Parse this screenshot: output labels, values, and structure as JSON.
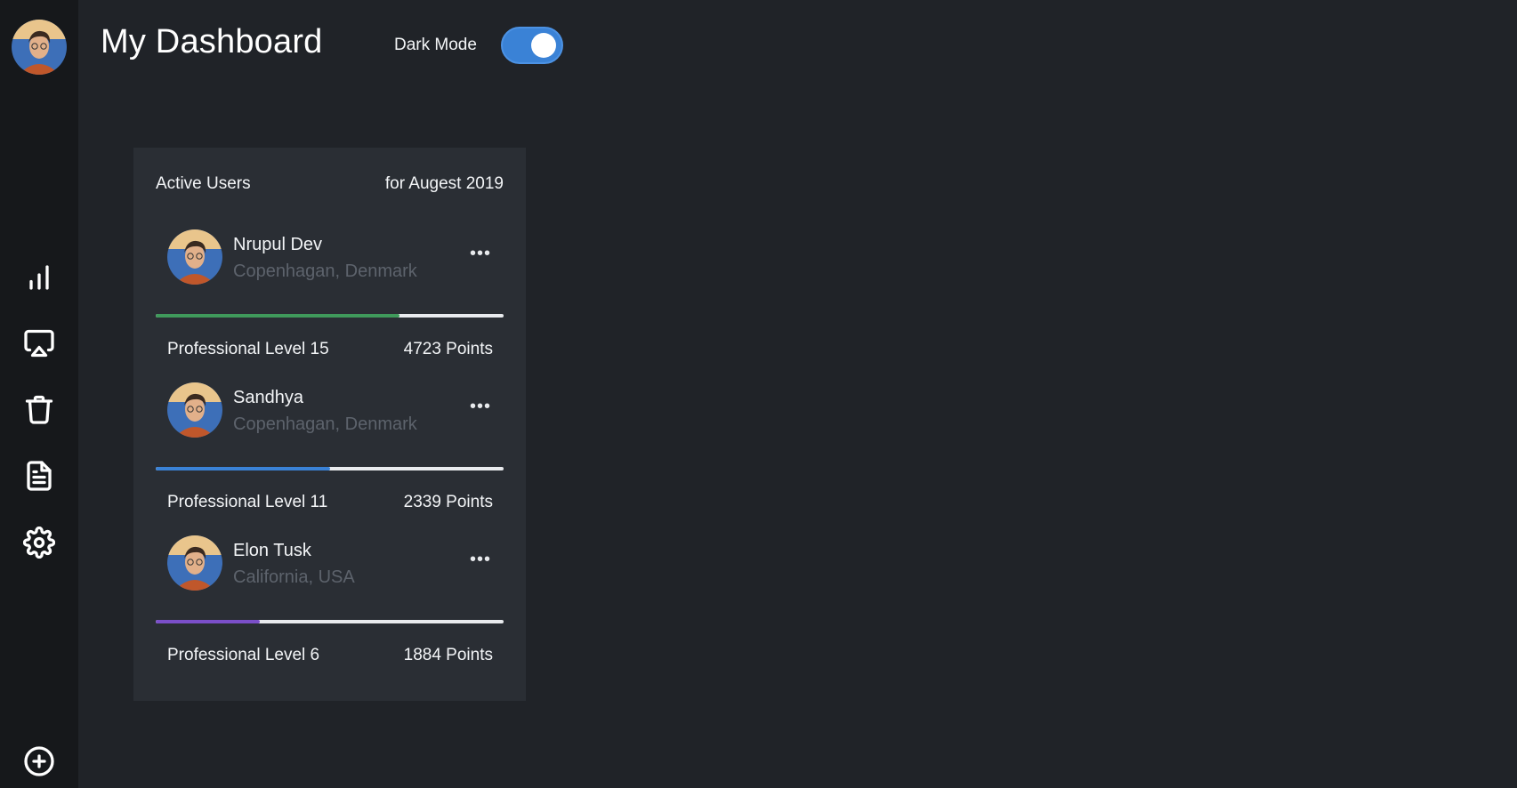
{
  "header": {
    "title": "My Dashboard",
    "dark_mode_label": "Dark Mode",
    "dark_mode_on": true
  },
  "sidebar": {
    "items": [
      {
        "icon": "bar-chart-icon"
      },
      {
        "icon": "airplay-icon"
      },
      {
        "icon": "trash-icon"
      },
      {
        "icon": "document-icon"
      },
      {
        "icon": "gear-icon"
      }
    ],
    "bottom_icon": "plus-circle-icon"
  },
  "card": {
    "title": "Active Users",
    "period": "for Augest 2019",
    "users": [
      {
        "name": "Nrupul Dev",
        "location": "Copenhagan, Denmark",
        "level": "Professional Level 15",
        "points": "4723 Points",
        "progress": 0.7,
        "color": "#3f9a5b"
      },
      {
        "name": "Sandhya",
        "location": "Copenhagan, Denmark",
        "level": "Professional Level 11",
        "points": "2339 Points",
        "progress": 0.5,
        "color": "#3a82d6"
      },
      {
        "name": "Elon Tusk",
        "location": "California, USA",
        "level": "Professional Level 6",
        "points": "1884 Points",
        "progress": 0.3,
        "color": "#7b4fc9"
      }
    ]
  },
  "colors": {
    "background": "#202328",
    "sidebar": "#16181b",
    "card": "#2a2e34",
    "accent": "#3a82d6"
  }
}
